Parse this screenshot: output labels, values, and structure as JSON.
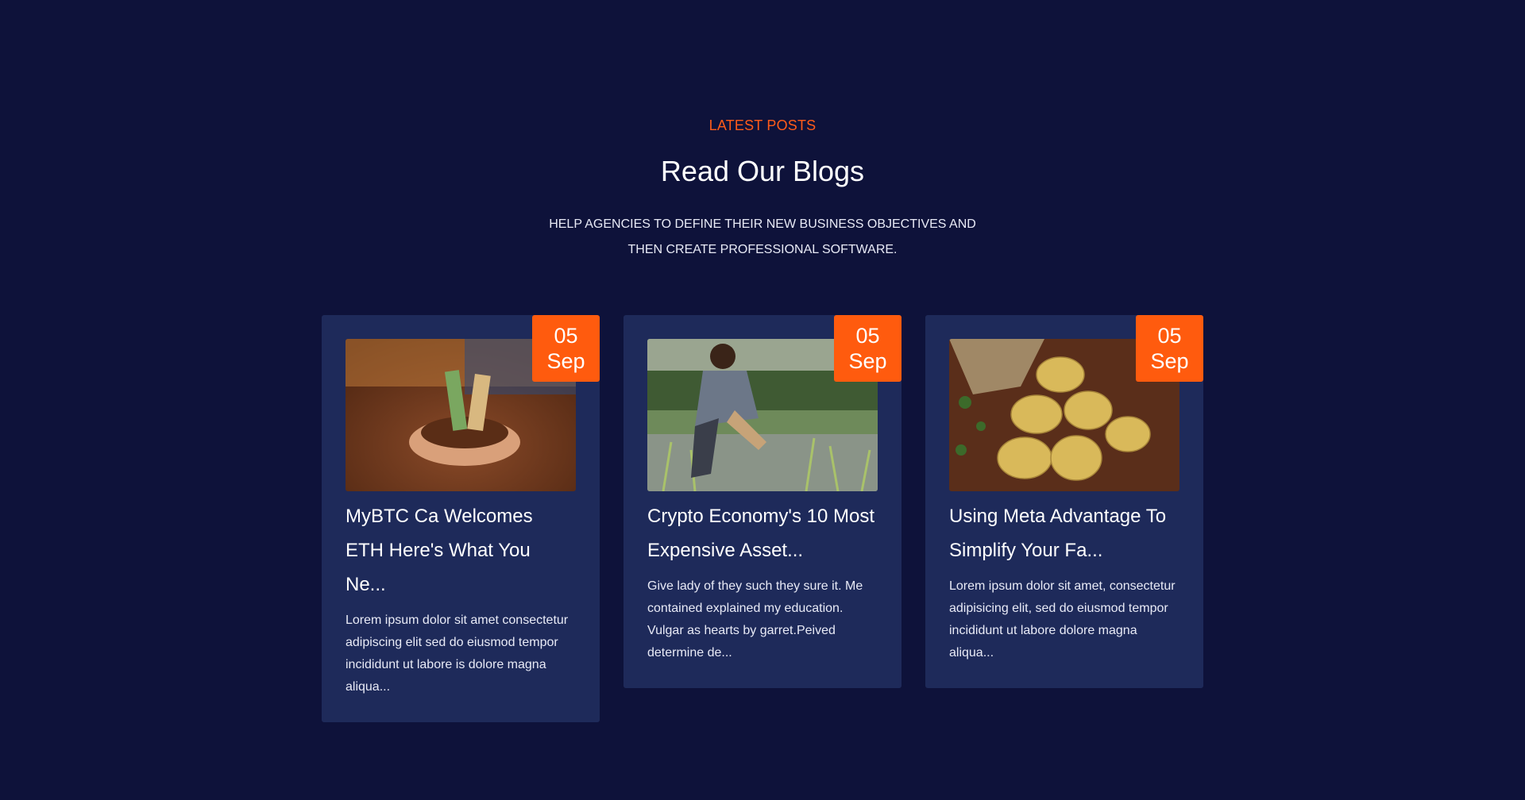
{
  "section": {
    "eyebrow": "LATEST POSTS",
    "title": "Read Our Blogs",
    "subtitle": "HELP AGENCIES TO DEFINE THEIR NEW BUSINESS OBJECTIVES AND THEN CREATE PROFESSIONAL SOFTWARE."
  },
  "colors": {
    "background": "#0e123a",
    "card": "#1e2a5a",
    "accent": "#ff5b0e"
  },
  "posts": [
    {
      "day": "05",
      "month": "Sep",
      "title": "MyBTC Ca Welcomes ETH Here's What You Ne...",
      "excerpt": "Lorem ipsum dolor sit amet consectetur adipiscing elit sed do eiusmod tempor incididunt ut labore is dolore magna aliqua...",
      "image": "hands-holding-soil-with-money-image"
    },
    {
      "day": "05",
      "month": "Sep",
      "title": "Crypto Economy's 10 Most Expensive Asset...",
      "excerpt": "Give lady of they such they sure it. Me contained explained my education. Vulgar as hearts by garret.Peived determine de...",
      "image": "farmer-planting-rice-image"
    },
    {
      "day": "05",
      "month": "Sep",
      "title": "Using Meta Advantage To Simplify Your Fa...",
      "excerpt": "Lorem ipsum dolor sit amet, consectetur adipisicing elit, sed do eiusmod tempor incididunt ut labore dolore magna aliqua...",
      "image": "potatoes-spilling-from-sack-image"
    }
  ]
}
